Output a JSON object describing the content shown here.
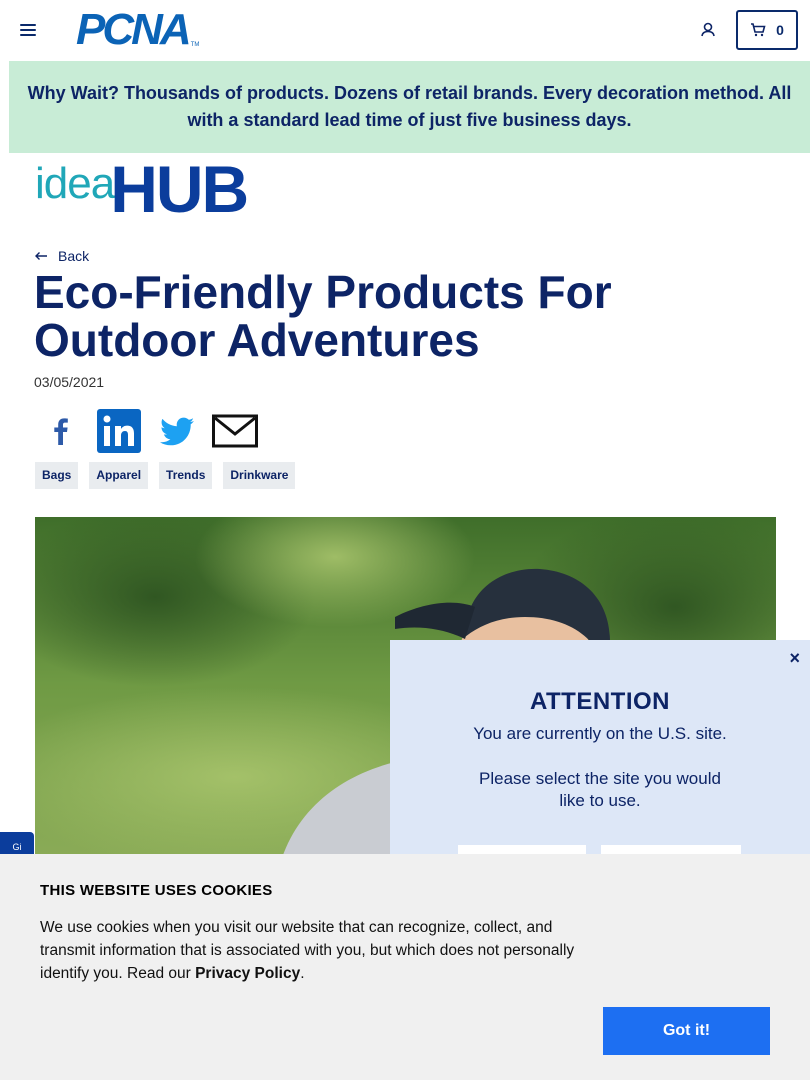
{
  "header": {
    "logo_text": "PCNA",
    "logo_tm": "TM",
    "cart_count": "0"
  },
  "promo": {
    "text": "Why Wait? Thousands of products. Dozens of retail brands. Every decoration method. All with a standard lead time of just five business days."
  },
  "ideahub": {
    "idea": "idea",
    "hub": "HUB"
  },
  "article": {
    "back_label": "Back",
    "title": "Eco-Friendly Products For Outdoor Adventures",
    "date": "03/05/2021",
    "tags": [
      "Bags",
      "Apparel",
      "Trends",
      "Drinkware"
    ]
  },
  "side_tab": {
    "label": "Gi"
  },
  "attention_modal": {
    "close_label": "×",
    "title": "ATTENTION",
    "line1": "You are currently on the U.S. site.",
    "line2": "Please select the site you would like to use."
  },
  "cookie_banner": {
    "title": "THIS WEBSITE USES COOKIES",
    "text_before": "We use cookies when you visit our website that can recognize, collect, and transmit information that is associated with you, but which does not personally identify you. Read our ",
    "link_label": "Privacy Policy",
    "text_after": ".",
    "button_label": "Got it!"
  },
  "colors": {
    "navy": "#0d2466",
    "brand_blue": "#0b63b6",
    "promo_bg": "#c8ecd6",
    "modal_bg": "#dde7f7",
    "cookie_btn": "#1d6ff2"
  },
  "icons": [
    "menu-icon",
    "account-icon",
    "cart-icon",
    "back-arrow-icon",
    "facebook-icon",
    "linkedin-icon",
    "twitter-icon",
    "email-icon",
    "close-icon"
  ]
}
